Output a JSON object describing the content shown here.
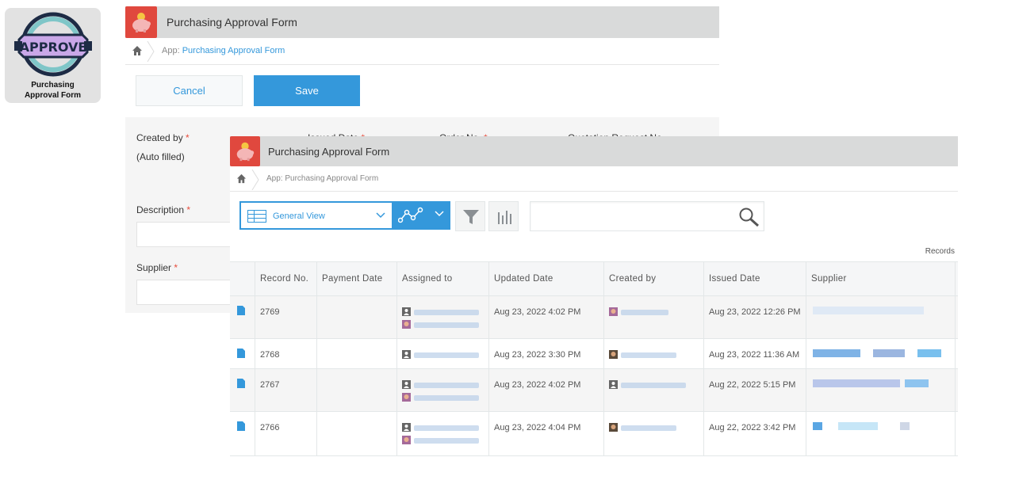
{
  "tile": {
    "badge": "APPROVE",
    "line1": "Purchasing",
    "line2": "Approval Form"
  },
  "colors": {
    "accent": "#3498db",
    "app_icon_bg": "#e0483e",
    "titlebar": "#d9dada",
    "required": "#e74c3c"
  },
  "back_window": {
    "title": "Purchasing Approval Form",
    "breadcrumb_prefix": "App:",
    "breadcrumb_app": "Purchasing Approval Form",
    "cancel_label": "Cancel",
    "save_label": "Save",
    "fields": {
      "created_by_label": "Created by",
      "created_by_value": "(Auto filled)",
      "issued_date_label": "Issued Date",
      "order_no_label": "Order No.",
      "quotation_label": "Quotation Request No.",
      "description_label": "Description",
      "supplier_label": "Supplier",
      "required_mark": "*"
    }
  },
  "front_window": {
    "title": "Purchasing Approval Form",
    "breadcrumb": "App: Purchasing Approval Form",
    "view_label": "General View",
    "records_label": "Records",
    "columns": [
      "Record No.",
      "Payment Date",
      "Assigned to",
      "Updated Date",
      "Created by",
      "Issued Date",
      "Supplier"
    ],
    "rows": [
      {
        "record": "2769",
        "payment": "",
        "assignees": 2,
        "updated": "Aug 23, 2022 4:02 PM",
        "issued": "Aug 23, 2022 12:26 PM"
      },
      {
        "record": "2768",
        "payment": "",
        "assignees": 1,
        "updated": "Aug 23, 2022 3:30 PM",
        "issued": "Aug 23, 2022 11:36 AM"
      },
      {
        "record": "2767",
        "payment": "",
        "assignees": 2,
        "updated": "Aug 23, 2022 4:02 PM",
        "issued": "Aug 22, 2022 5:15 PM"
      },
      {
        "record": "2766",
        "payment": "",
        "assignees": 2,
        "updated": "Aug 23, 2022 4:04 PM",
        "issued": "Aug 22, 2022 3:42 PM"
      }
    ]
  }
}
